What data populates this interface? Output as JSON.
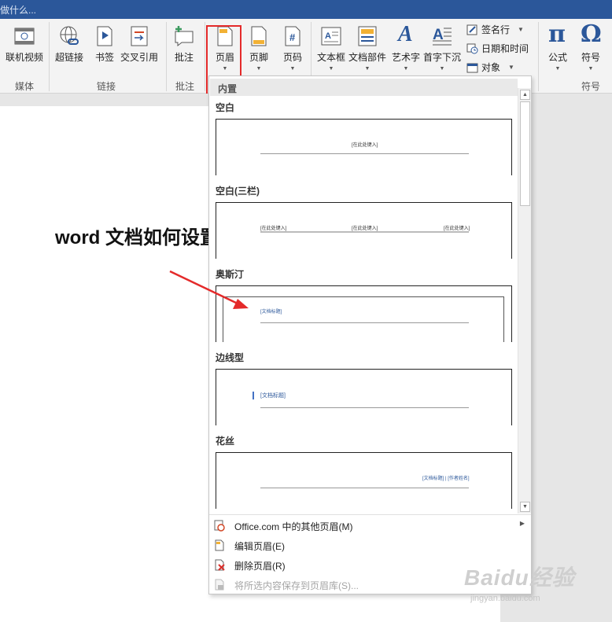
{
  "title_bar": {
    "search_hint": "做什么..."
  },
  "ribbon": {
    "buttons": {
      "online_video": "联机视频",
      "hyperlink": "超链接",
      "bookmark": "书签",
      "cross_reference": "交叉引用",
      "comment": "批注",
      "header": "页眉",
      "footer": "页脚",
      "page_number": "页码",
      "text_box": "文本框",
      "quick_parts": "文档部件",
      "wordart": "艺术字",
      "drop_cap": "首字下沉",
      "equation": "公式",
      "symbol": "符号"
    },
    "small_buttons": {
      "signature_line": "签名行",
      "date_time": "日期和时间",
      "object": "对象"
    },
    "groups": {
      "media": "媒体",
      "links": "链接",
      "comments": "批注",
      "symbols": "符号"
    },
    "icon_glyphs": {
      "equation": "π",
      "symbol": "Ω",
      "wordart": "A",
      "page_number": "#"
    }
  },
  "document": {
    "heading": "word 文档如何设置页眉"
  },
  "header_gallery": {
    "section_label": "内置",
    "items": [
      {
        "name": "空白",
        "placeholders": [
          "[在此处键入]"
        ]
      },
      {
        "name": "空白(三栏)",
        "placeholders": [
          "[在此处键入]",
          "[在此处键入]",
          "[在此处键入]"
        ]
      },
      {
        "name": "奥斯汀",
        "placeholders": [
          "[文档标题]"
        ]
      },
      {
        "name": "边线型",
        "placeholders": [
          "[文档标题]"
        ]
      },
      {
        "name": "花丝",
        "placeholders": [
          "[文档标题] | [作者姓名]"
        ]
      }
    ]
  },
  "menu": {
    "more_headers": "Office.com 中的其他页眉(M)",
    "edit_header": "编辑页眉(E)",
    "remove_header": "删除页眉(R)",
    "save_selection": "将所选内容保存到页眉库(S)..."
  },
  "watermark": {
    "brand": "Baidu经验",
    "url": "jingyan.baidu.com"
  },
  "colors": {
    "title_bar": "#2b579a",
    "highlight": "#e42a2a",
    "accent_blue": "#2b579a"
  }
}
